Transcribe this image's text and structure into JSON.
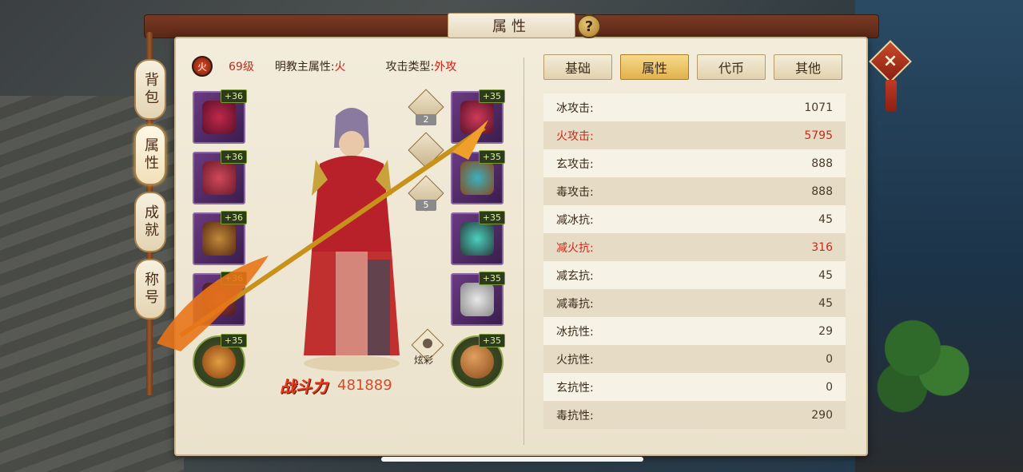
{
  "title": "属性",
  "help": "?",
  "close": "×",
  "side_tabs": [
    {
      "label": "背包",
      "active": false
    },
    {
      "label": "属性",
      "active": true
    },
    {
      "label": "成就",
      "active": false
    },
    {
      "label": "称号",
      "active": false
    }
  ],
  "header": {
    "level": "69级",
    "sect_label": "明教主属性:",
    "sect_value": "火",
    "attack_type_label": "攻击类型:",
    "attack_type_value": "外攻"
  },
  "equipment_left": [
    {
      "icon": "headgear-icon",
      "bonus": "+36"
    },
    {
      "icon": "armor-icon",
      "bonus": "+36"
    },
    {
      "icon": "belt-icon",
      "bonus": "+36"
    },
    {
      "icon": "boots-icon",
      "bonus": "+36"
    },
    {
      "icon": "pet-icon",
      "bonus": "+35"
    }
  ],
  "equipment_right": [
    {
      "icon": "bracer-icon",
      "bonus": "+35"
    },
    {
      "icon": "necklace-icon",
      "bonus": "+35"
    },
    {
      "icon": "ring-icon",
      "bonus": "+35"
    },
    {
      "icon": "pendant-icon",
      "bonus": "+35"
    },
    {
      "icon": "stone-icon",
      "bonus": "+35"
    }
  ],
  "mini_icons": [
    {
      "icon": "hammer-icon",
      "count": "2"
    },
    {
      "icon": "spark-icon",
      "count": ""
    },
    {
      "icon": "gem-icon",
      "count": "5"
    }
  ],
  "style_button": "炫彩",
  "power": {
    "label": "战斗力",
    "value": "481889"
  },
  "tabs": [
    {
      "label": "基础",
      "active": false
    },
    {
      "label": "属性",
      "active": true
    },
    {
      "label": "代币",
      "active": false
    },
    {
      "label": "其他",
      "active": false
    }
  ],
  "stats": [
    {
      "label": "冰攻击:",
      "value": "1071",
      "highlight": false
    },
    {
      "label": "火攻击:",
      "value": "5795",
      "highlight": true
    },
    {
      "label": "玄攻击:",
      "value": "888",
      "highlight": false
    },
    {
      "label": "毒攻击:",
      "value": "888",
      "highlight": false
    },
    {
      "label": "减冰抗:",
      "value": "45",
      "highlight": false
    },
    {
      "label": "减火抗:",
      "value": "316",
      "highlight": true
    },
    {
      "label": "减玄抗:",
      "value": "45",
      "highlight": false
    },
    {
      "label": "减毒抗:",
      "value": "45",
      "highlight": false
    },
    {
      "label": "冰抗性:",
      "value": "29",
      "highlight": false
    },
    {
      "label": "火抗性:",
      "value": "0",
      "highlight": false
    },
    {
      "label": "玄抗性:",
      "value": "0",
      "highlight": false
    },
    {
      "label": "毒抗性:",
      "value": "290",
      "highlight": false
    }
  ],
  "colors": {
    "highlight": "#c82a1a",
    "active_tab": "#e1b24c",
    "slot": "#6a3a82"
  }
}
